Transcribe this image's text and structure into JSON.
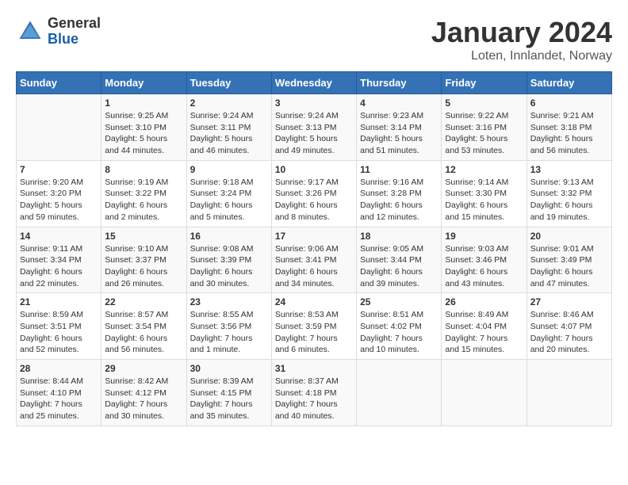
{
  "header": {
    "logo": {
      "general": "General",
      "blue": "Blue"
    },
    "title": "January 2024",
    "location": "Loten, Innlandet, Norway"
  },
  "calendar": {
    "days_of_week": [
      "Sunday",
      "Monday",
      "Tuesday",
      "Wednesday",
      "Thursday",
      "Friday",
      "Saturday"
    ],
    "weeks": [
      [
        {
          "day": "",
          "info": ""
        },
        {
          "day": "1",
          "info": "Sunrise: 9:25 AM\nSunset: 3:10 PM\nDaylight: 5 hours\nand 44 minutes."
        },
        {
          "day": "2",
          "info": "Sunrise: 9:24 AM\nSunset: 3:11 PM\nDaylight: 5 hours\nand 46 minutes."
        },
        {
          "day": "3",
          "info": "Sunrise: 9:24 AM\nSunset: 3:13 PM\nDaylight: 5 hours\nand 49 minutes."
        },
        {
          "day": "4",
          "info": "Sunrise: 9:23 AM\nSunset: 3:14 PM\nDaylight: 5 hours\nand 51 minutes."
        },
        {
          "day": "5",
          "info": "Sunrise: 9:22 AM\nSunset: 3:16 PM\nDaylight: 5 hours\nand 53 minutes."
        },
        {
          "day": "6",
          "info": "Sunrise: 9:21 AM\nSunset: 3:18 PM\nDaylight: 5 hours\nand 56 minutes."
        }
      ],
      [
        {
          "day": "7",
          "info": "Sunrise: 9:20 AM\nSunset: 3:20 PM\nDaylight: 5 hours\nand 59 minutes."
        },
        {
          "day": "8",
          "info": "Sunrise: 9:19 AM\nSunset: 3:22 PM\nDaylight: 6 hours\nand 2 minutes."
        },
        {
          "day": "9",
          "info": "Sunrise: 9:18 AM\nSunset: 3:24 PM\nDaylight: 6 hours\nand 5 minutes."
        },
        {
          "day": "10",
          "info": "Sunrise: 9:17 AM\nSunset: 3:26 PM\nDaylight: 6 hours\nand 8 minutes."
        },
        {
          "day": "11",
          "info": "Sunrise: 9:16 AM\nSunset: 3:28 PM\nDaylight: 6 hours\nand 12 minutes."
        },
        {
          "day": "12",
          "info": "Sunrise: 9:14 AM\nSunset: 3:30 PM\nDaylight: 6 hours\nand 15 minutes."
        },
        {
          "day": "13",
          "info": "Sunrise: 9:13 AM\nSunset: 3:32 PM\nDaylight: 6 hours\nand 19 minutes."
        }
      ],
      [
        {
          "day": "14",
          "info": "Sunrise: 9:11 AM\nSunset: 3:34 PM\nDaylight: 6 hours\nand 22 minutes."
        },
        {
          "day": "15",
          "info": "Sunrise: 9:10 AM\nSunset: 3:37 PM\nDaylight: 6 hours\nand 26 minutes."
        },
        {
          "day": "16",
          "info": "Sunrise: 9:08 AM\nSunset: 3:39 PM\nDaylight: 6 hours\nand 30 minutes."
        },
        {
          "day": "17",
          "info": "Sunrise: 9:06 AM\nSunset: 3:41 PM\nDaylight: 6 hours\nand 34 minutes."
        },
        {
          "day": "18",
          "info": "Sunrise: 9:05 AM\nSunset: 3:44 PM\nDaylight: 6 hours\nand 39 minutes."
        },
        {
          "day": "19",
          "info": "Sunrise: 9:03 AM\nSunset: 3:46 PM\nDaylight: 6 hours\nand 43 minutes."
        },
        {
          "day": "20",
          "info": "Sunrise: 9:01 AM\nSunset: 3:49 PM\nDaylight: 6 hours\nand 47 minutes."
        }
      ],
      [
        {
          "day": "21",
          "info": "Sunrise: 8:59 AM\nSunset: 3:51 PM\nDaylight: 6 hours\nand 52 minutes."
        },
        {
          "day": "22",
          "info": "Sunrise: 8:57 AM\nSunset: 3:54 PM\nDaylight: 6 hours\nand 56 minutes."
        },
        {
          "day": "23",
          "info": "Sunrise: 8:55 AM\nSunset: 3:56 PM\nDaylight: 7 hours\nand 1 minute."
        },
        {
          "day": "24",
          "info": "Sunrise: 8:53 AM\nSunset: 3:59 PM\nDaylight: 7 hours\nand 6 minutes."
        },
        {
          "day": "25",
          "info": "Sunrise: 8:51 AM\nSunset: 4:02 PM\nDaylight: 7 hours\nand 10 minutes."
        },
        {
          "day": "26",
          "info": "Sunrise: 8:49 AM\nSunset: 4:04 PM\nDaylight: 7 hours\nand 15 minutes."
        },
        {
          "day": "27",
          "info": "Sunrise: 8:46 AM\nSunset: 4:07 PM\nDaylight: 7 hours\nand 20 minutes."
        }
      ],
      [
        {
          "day": "28",
          "info": "Sunrise: 8:44 AM\nSunset: 4:10 PM\nDaylight: 7 hours\nand 25 minutes."
        },
        {
          "day": "29",
          "info": "Sunrise: 8:42 AM\nSunset: 4:12 PM\nDaylight: 7 hours\nand 30 minutes."
        },
        {
          "day": "30",
          "info": "Sunrise: 8:39 AM\nSunset: 4:15 PM\nDaylight: 7 hours\nand 35 minutes."
        },
        {
          "day": "31",
          "info": "Sunrise: 8:37 AM\nSunset: 4:18 PM\nDaylight: 7 hours\nand 40 minutes."
        },
        {
          "day": "",
          "info": ""
        },
        {
          "day": "",
          "info": ""
        },
        {
          "day": "",
          "info": ""
        }
      ]
    ]
  }
}
